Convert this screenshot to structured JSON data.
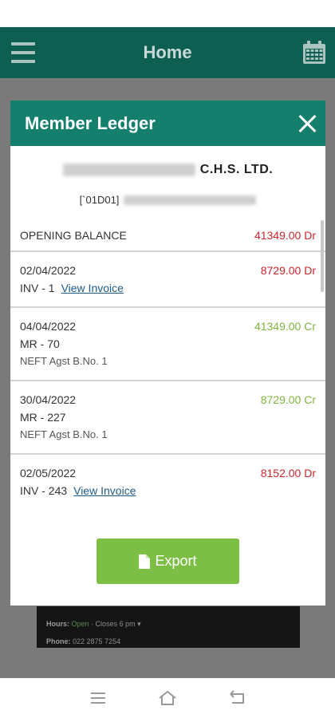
{
  "app_bar": {
    "title": "Home",
    "menu_icon": "menu-icon",
    "calendar_icon": "calendar-icon"
  },
  "background_card": {
    "hours_label": "Hours:",
    "hours_status": "Open",
    "hours_detail": "· Closes 6 pm ▾",
    "phone_label": "Phone:",
    "phone_value": "022 2875 7254"
  },
  "modal": {
    "title": "Member Ledger",
    "society_suffix": "C.H.S. LTD.",
    "member_code": "[`01D01]",
    "rows": [
      {
        "label": "OPENING BALANCE",
        "amount": "41349.00 Dr",
        "type": "dr"
      },
      {
        "date": "02/04/2022",
        "ref": "INV - 1",
        "link": "View Invoice",
        "amount": "8729.00 Dr",
        "type": "dr"
      },
      {
        "date": "04/04/2022",
        "ref": "MR - 70",
        "note": "NEFT Agst B.No. 1",
        "amount": "41349.00 Cr",
        "type": "cr"
      },
      {
        "date": "30/04/2022",
        "ref": "MR - 227",
        "note": "NEFT Agst B.No. 1",
        "amount": "8729.00 Cr",
        "type": "cr"
      },
      {
        "date": "02/05/2022",
        "ref": "INV - 243",
        "link": "View Invoice",
        "amount": "8152.00 Dr",
        "type": "dr"
      }
    ],
    "export_label": "Export"
  },
  "colors": {
    "app_bar": "#0d5f52",
    "modal_header": "#157f6d",
    "debit": "#c9262d",
    "credit": "#7fb43f",
    "export": "#7dbf45"
  }
}
